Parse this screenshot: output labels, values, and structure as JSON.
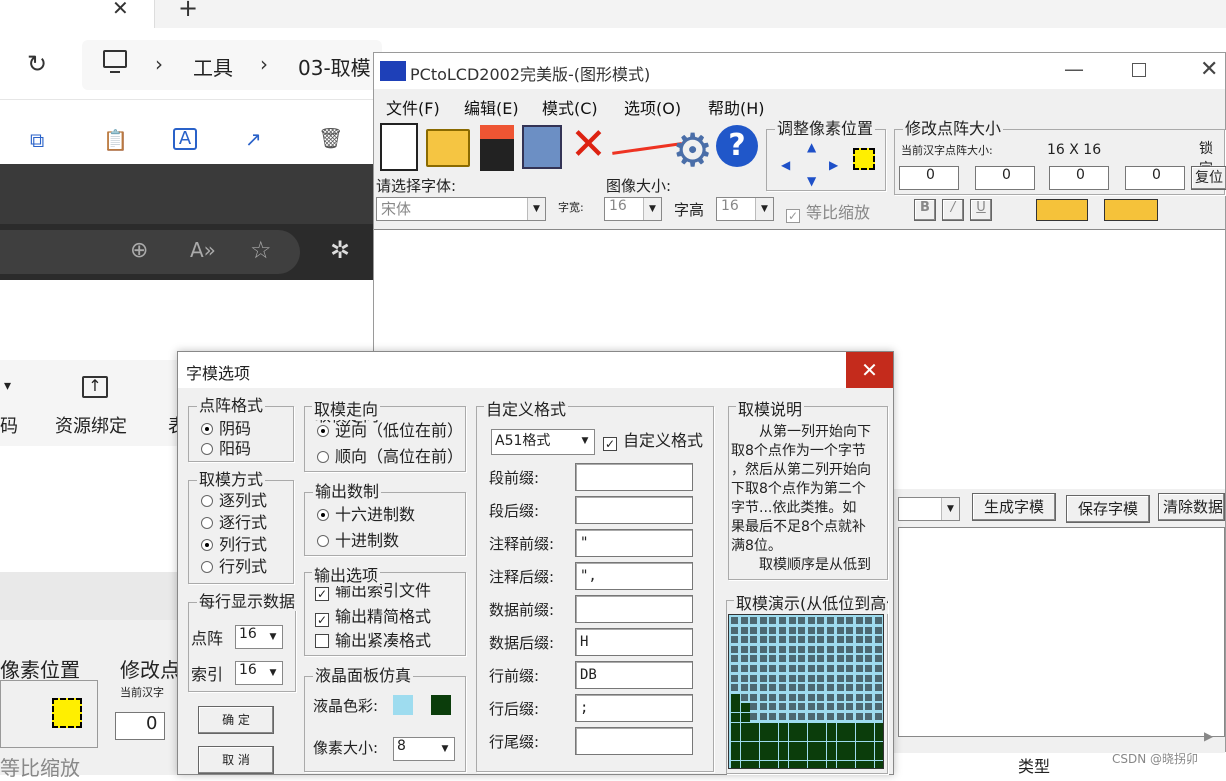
{
  "browser": {
    "breadcrumb": [
      "工具",
      "03-取模"
    ],
    "ribbon_label_partial": "码",
    "ribbon_item": "资源绑定",
    "ribbon_more": "表"
  },
  "bg_clone": {
    "pixel_pos": "像素位置",
    "modify_partial": "修改点",
    "current_label": "当前汉字",
    "equal_scale": "等比缩放",
    "value": "0"
  },
  "app": {
    "title": "PCtoLCD2002完美版-(图形模式)",
    "menu": [
      "文件(F)",
      "编辑(E)",
      "模式(C)",
      "选项(O)",
      "帮助(H)"
    ],
    "font_label": "请选择字体:",
    "font_value": "宋体",
    "width_label": "字宽:",
    "image_size_label": "图像大小:",
    "width_value": "16",
    "height_label": "字高",
    "height_value": "16",
    "equal_scale": "等比缩放",
    "adjust_label": "调整像素位置",
    "resize_label": "修改点阵大小",
    "current_size_label": "当前汉字点阵大小:",
    "current_size_value": "16 X 16",
    "lock_label": "锁定",
    "reset_label": "复位",
    "steppers": [
      "0",
      "0",
      "0",
      "0"
    ],
    "style_buttons": [
      "B",
      "/",
      "U"
    ],
    "generate_btn": "生成字模",
    "save_btn": "保存字模",
    "clear_btn": "清除数据",
    "type_label": "类型"
  },
  "dialog": {
    "title": "字模选项",
    "dot_format": {
      "title": "点阵格式",
      "options": [
        "阴码",
        "阳码"
      ],
      "selected": 0
    },
    "mode": {
      "title": "取模方式",
      "options": [
        "逐列式",
        "逐行式",
        "列行式",
        "行列式"
      ],
      "selected": 2
    },
    "per_line": {
      "title": "每行显示数据",
      "dot_label": "点阵",
      "dot_value": "16",
      "index_label": "索引",
      "index_value": "16"
    },
    "ok_btn": "确 定",
    "cancel_btn": "取 消",
    "direction": {
      "title": "取模走向",
      "options": [
        "逆向（低位在前）",
        "顺向（高位在前）"
      ],
      "selected": 0
    },
    "radix": {
      "title": "输出数制",
      "options": [
        "十六进制数",
        "十进制数"
      ],
      "selected": 0
    },
    "output": {
      "title": "输出选项",
      "options": [
        "输出索引文件",
        "输出精简格式",
        "输出紧凑格式"
      ],
      "checked": [
        true,
        true,
        false
      ]
    },
    "lcd": {
      "title": "液晶面板仿真",
      "color_label": "液晶色彩:",
      "size_label": "像素大小:",
      "size_value": "8",
      "color_bg": "#9edcef",
      "color_fg": "#0b3d0b"
    },
    "custom": {
      "title": "自定义格式",
      "format_value": "A51格式",
      "custom_check": "自定义格式",
      "fields": [
        {
          "label": "段前缀:",
          "value": ""
        },
        {
          "label": "段后缀:",
          "value": ""
        },
        {
          "label": "注释前缀:",
          "value": "\""
        },
        {
          "label": "注释后缀:",
          "value": "\","
        },
        {
          "label": "数据前缀:",
          "value": ""
        },
        {
          "label": "数据后缀:",
          "value": "H"
        },
        {
          "label": "行前缀:",
          "value": "DB"
        },
        {
          "label": "行后缀:",
          "value": ";"
        },
        {
          "label": "行尾缀:",
          "value": ""
        }
      ]
    },
    "explain": {
      "title": "取模说明",
      "lines": [
        "从第一列开始向下",
        "取8个点作为一个字节",
        "，然后从第二列开始向",
        "下取8个点作为第二个",
        "字节...依此类推。如",
        "果最后不足8个点就补",
        "满8位。",
        "取模顺序是从低到"
      ]
    },
    "demo": {
      "title": "取模演示(从低位到高位)"
    }
  },
  "watermark": "CSDN @晓拐卯"
}
